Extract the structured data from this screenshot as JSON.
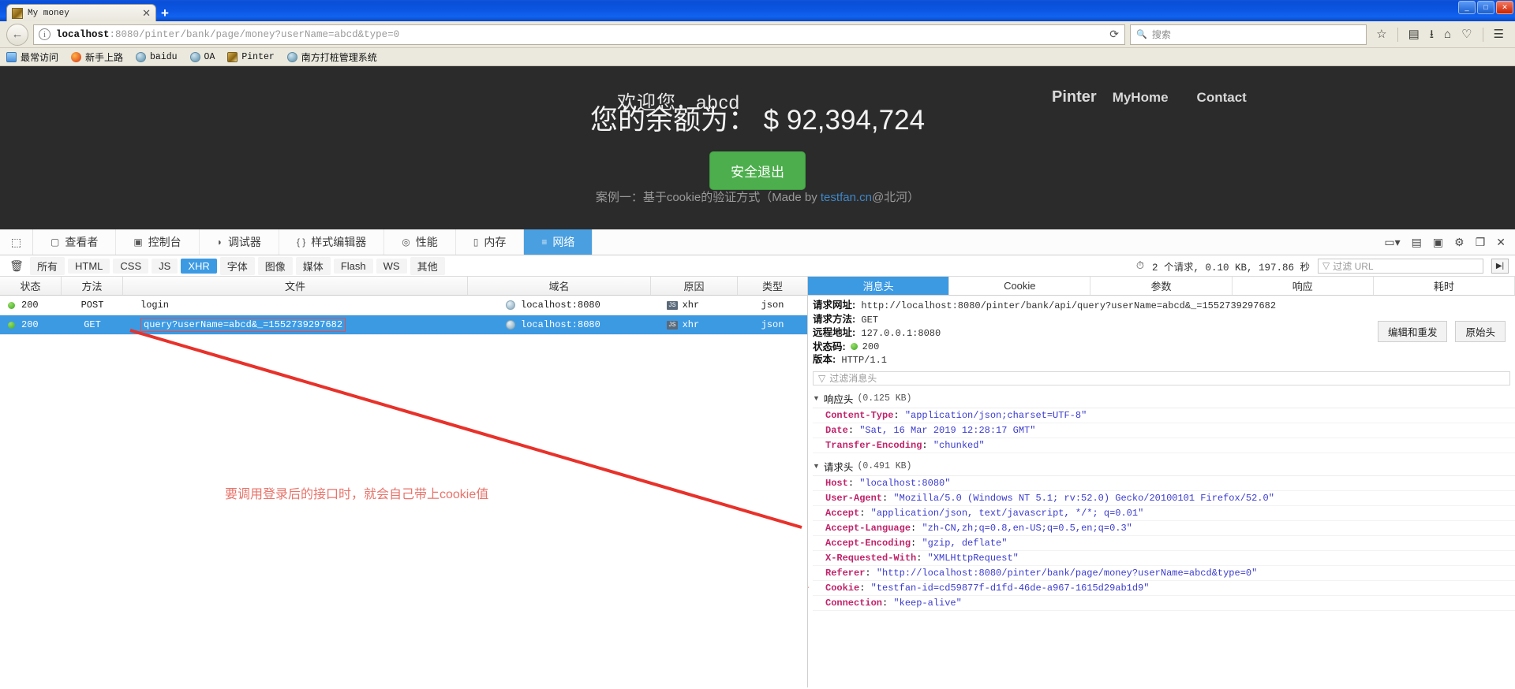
{
  "window": {
    "minimize_label": "_",
    "maximize_label": "□",
    "close_label": "✕"
  },
  "browser": {
    "tab": {
      "title": "My money",
      "close_label": "✕",
      "favicon": "gold-tab-icon"
    },
    "new_tab_label": "+",
    "back_label": "←",
    "url_scheme_host": "localhost",
    "url_rest": ":8080/pinter/bank/page/money?userName=abcd&type=0",
    "reload_label": "⟳",
    "search_placeholder": "搜索",
    "search_icon": "🔍",
    "toolbar_icons": [
      "star-icon",
      "library-icon",
      "downloads-icon",
      "home-icon",
      "pocket-icon",
      "menu-icon"
    ],
    "bookmarks": [
      {
        "label": "最常访问",
        "icon": "folder"
      },
      {
        "label": "新手上路",
        "icon": "fox"
      },
      {
        "label": "baidu",
        "icon": "globe",
        "mono": true
      },
      {
        "label": "OA",
        "icon": "globe",
        "mono": true
      },
      {
        "label": "Pinter",
        "icon": "gold",
        "mono": true
      },
      {
        "label": "南方打桩管理系统",
        "icon": "globe"
      }
    ]
  },
  "page": {
    "brand": "Pinter",
    "nav_links": [
      "MyHome",
      "Contact"
    ],
    "welcome": "欢迎您，abcd",
    "balance": "您的余额为： $ 92,394,724",
    "logout_button": "安全退出",
    "footer_prefix": "案例一：基于cookie的验证方式（Made by ",
    "footer_link": "testfan.cn",
    "footer_suffix": "@北河）"
  },
  "devtools": {
    "picker_icon": "node-picker-icon",
    "tabs": [
      {
        "label": "查看者",
        "icon": "inspector-icon",
        "active": false
      },
      {
        "label": "控制台",
        "icon": "console-icon",
        "active": false
      },
      {
        "label": "调试器",
        "icon": "debugger-icon",
        "active": false
      },
      {
        "label": "样式编辑器",
        "icon": "style-editor-icon",
        "active": false
      },
      {
        "label": "性能",
        "icon": "performance-icon",
        "active": false
      },
      {
        "label": "内存",
        "icon": "memory-icon",
        "active": false
      },
      {
        "label": "网络",
        "icon": "network-icon",
        "active": true
      }
    ],
    "topbar_right_icons": [
      "responsive-design-icon",
      "split-console-icon",
      "dock-bottom-icon",
      "settings-gear-icon",
      "dock-side-icon",
      "close-devtools-icon"
    ],
    "trash_icon": "trash-icon",
    "filters": [
      {
        "label": "所有",
        "active": false
      },
      {
        "label": "HTML",
        "active": false
      },
      {
        "label": "CSS",
        "active": false
      },
      {
        "label": "JS",
        "active": false
      },
      {
        "label": "XHR",
        "active": true
      },
      {
        "label": "字体",
        "active": false
      },
      {
        "label": "图像",
        "active": false
      },
      {
        "label": "媒体",
        "active": false
      },
      {
        "label": "Flash",
        "active": false
      },
      {
        "label": "WS",
        "active": false
      },
      {
        "label": "其他",
        "active": false
      }
    ],
    "request_summary": "2 个请求, 0.10 KB, 197.86 秒",
    "summary_icon": "clock-icon",
    "url_filter_placeholder": "过滤 URL",
    "url_filter_icon": "funnel-icon",
    "persist_icon": "persist-logs-icon",
    "columns": [
      "状态",
      "方法",
      "文件",
      "域名",
      "原因",
      "类型"
    ],
    "rows": [
      {
        "status": "200",
        "method": "POST",
        "file": "login",
        "domain": "localhost:8080",
        "cause": "xhr",
        "type": "json",
        "selected": false,
        "highlighted": false
      },
      {
        "status": "200",
        "method": "GET",
        "file": "query?userName=abcd&_=1552739297682",
        "domain": "localhost:8080",
        "cause": "xhr",
        "type": "json",
        "selected": true,
        "highlighted": true
      }
    ],
    "annotation": "要调用登录后的接口时，就会自己带上cookie值",
    "annotation_color": "#e8736a",
    "arrow_color": "#e8312a"
  },
  "detail": {
    "tabs": [
      {
        "label": "消息头",
        "active": true
      },
      {
        "label": "Cookie",
        "active": false
      },
      {
        "label": "参数",
        "active": false
      },
      {
        "label": "响应",
        "active": false
      },
      {
        "label": "耗时",
        "active": false
      }
    ],
    "summary": [
      {
        "key": "请求网址:",
        "value": "http://localhost:8080/pinter/bank/api/query?userName=abcd&_=1552739297682"
      },
      {
        "key": "请求方法:",
        "value": "GET"
      },
      {
        "key": "远程地址:",
        "value": "127.0.0.1:8080"
      },
      {
        "key": "状态码:",
        "value": "200",
        "has_dot": true
      },
      {
        "key": "版本:",
        "value": "HTTP/1.1"
      }
    ],
    "edit_resend_label": "编辑和重发",
    "raw_headers_label": "原始头",
    "filter_headers_placeholder": "过滤消息头",
    "groups": [
      {
        "title": "响应头",
        "size": "(0.125 KB)",
        "headers": [
          {
            "name": "Content-Type",
            "value": "\"application/json;charset=UTF-8\""
          },
          {
            "name": "Date",
            "value": "\"Sat, 16 Mar 2019 12:28:17 GMT\""
          },
          {
            "name": "Transfer-Encoding",
            "value": "\"chunked\""
          }
        ]
      },
      {
        "title": "请求头",
        "size": "(0.491 KB)",
        "headers": [
          {
            "name": "Host",
            "value": "\"localhost:8080\""
          },
          {
            "name": "User-Agent",
            "value": "\"Mozilla/5.0 (Windows NT 5.1; rv:52.0) Gecko/20100101 Firefox/52.0\""
          },
          {
            "name": "Accept",
            "value": "\"application/json, text/javascript, */*; q=0.01\""
          },
          {
            "name": "Accept-Language",
            "value": "\"zh-CN,zh;q=0.8,en-US;q=0.5,en;q=0.3\""
          },
          {
            "name": "Accept-Encoding",
            "value": "\"gzip, deflate\""
          },
          {
            "name": "X-Requested-With",
            "value": "\"XMLHttpRequest\""
          },
          {
            "name": "Referer",
            "value": "\"http://localhost:8080/pinter/bank/page/money?userName=abcd&type=0\""
          },
          {
            "name": "Cookie",
            "value": "\"testfan-id=cd59877f-d1fd-46de-a967-1615d29ab1d9\""
          },
          {
            "name": "Connection",
            "value": "\"keep-alive\""
          }
        ]
      }
    ]
  }
}
